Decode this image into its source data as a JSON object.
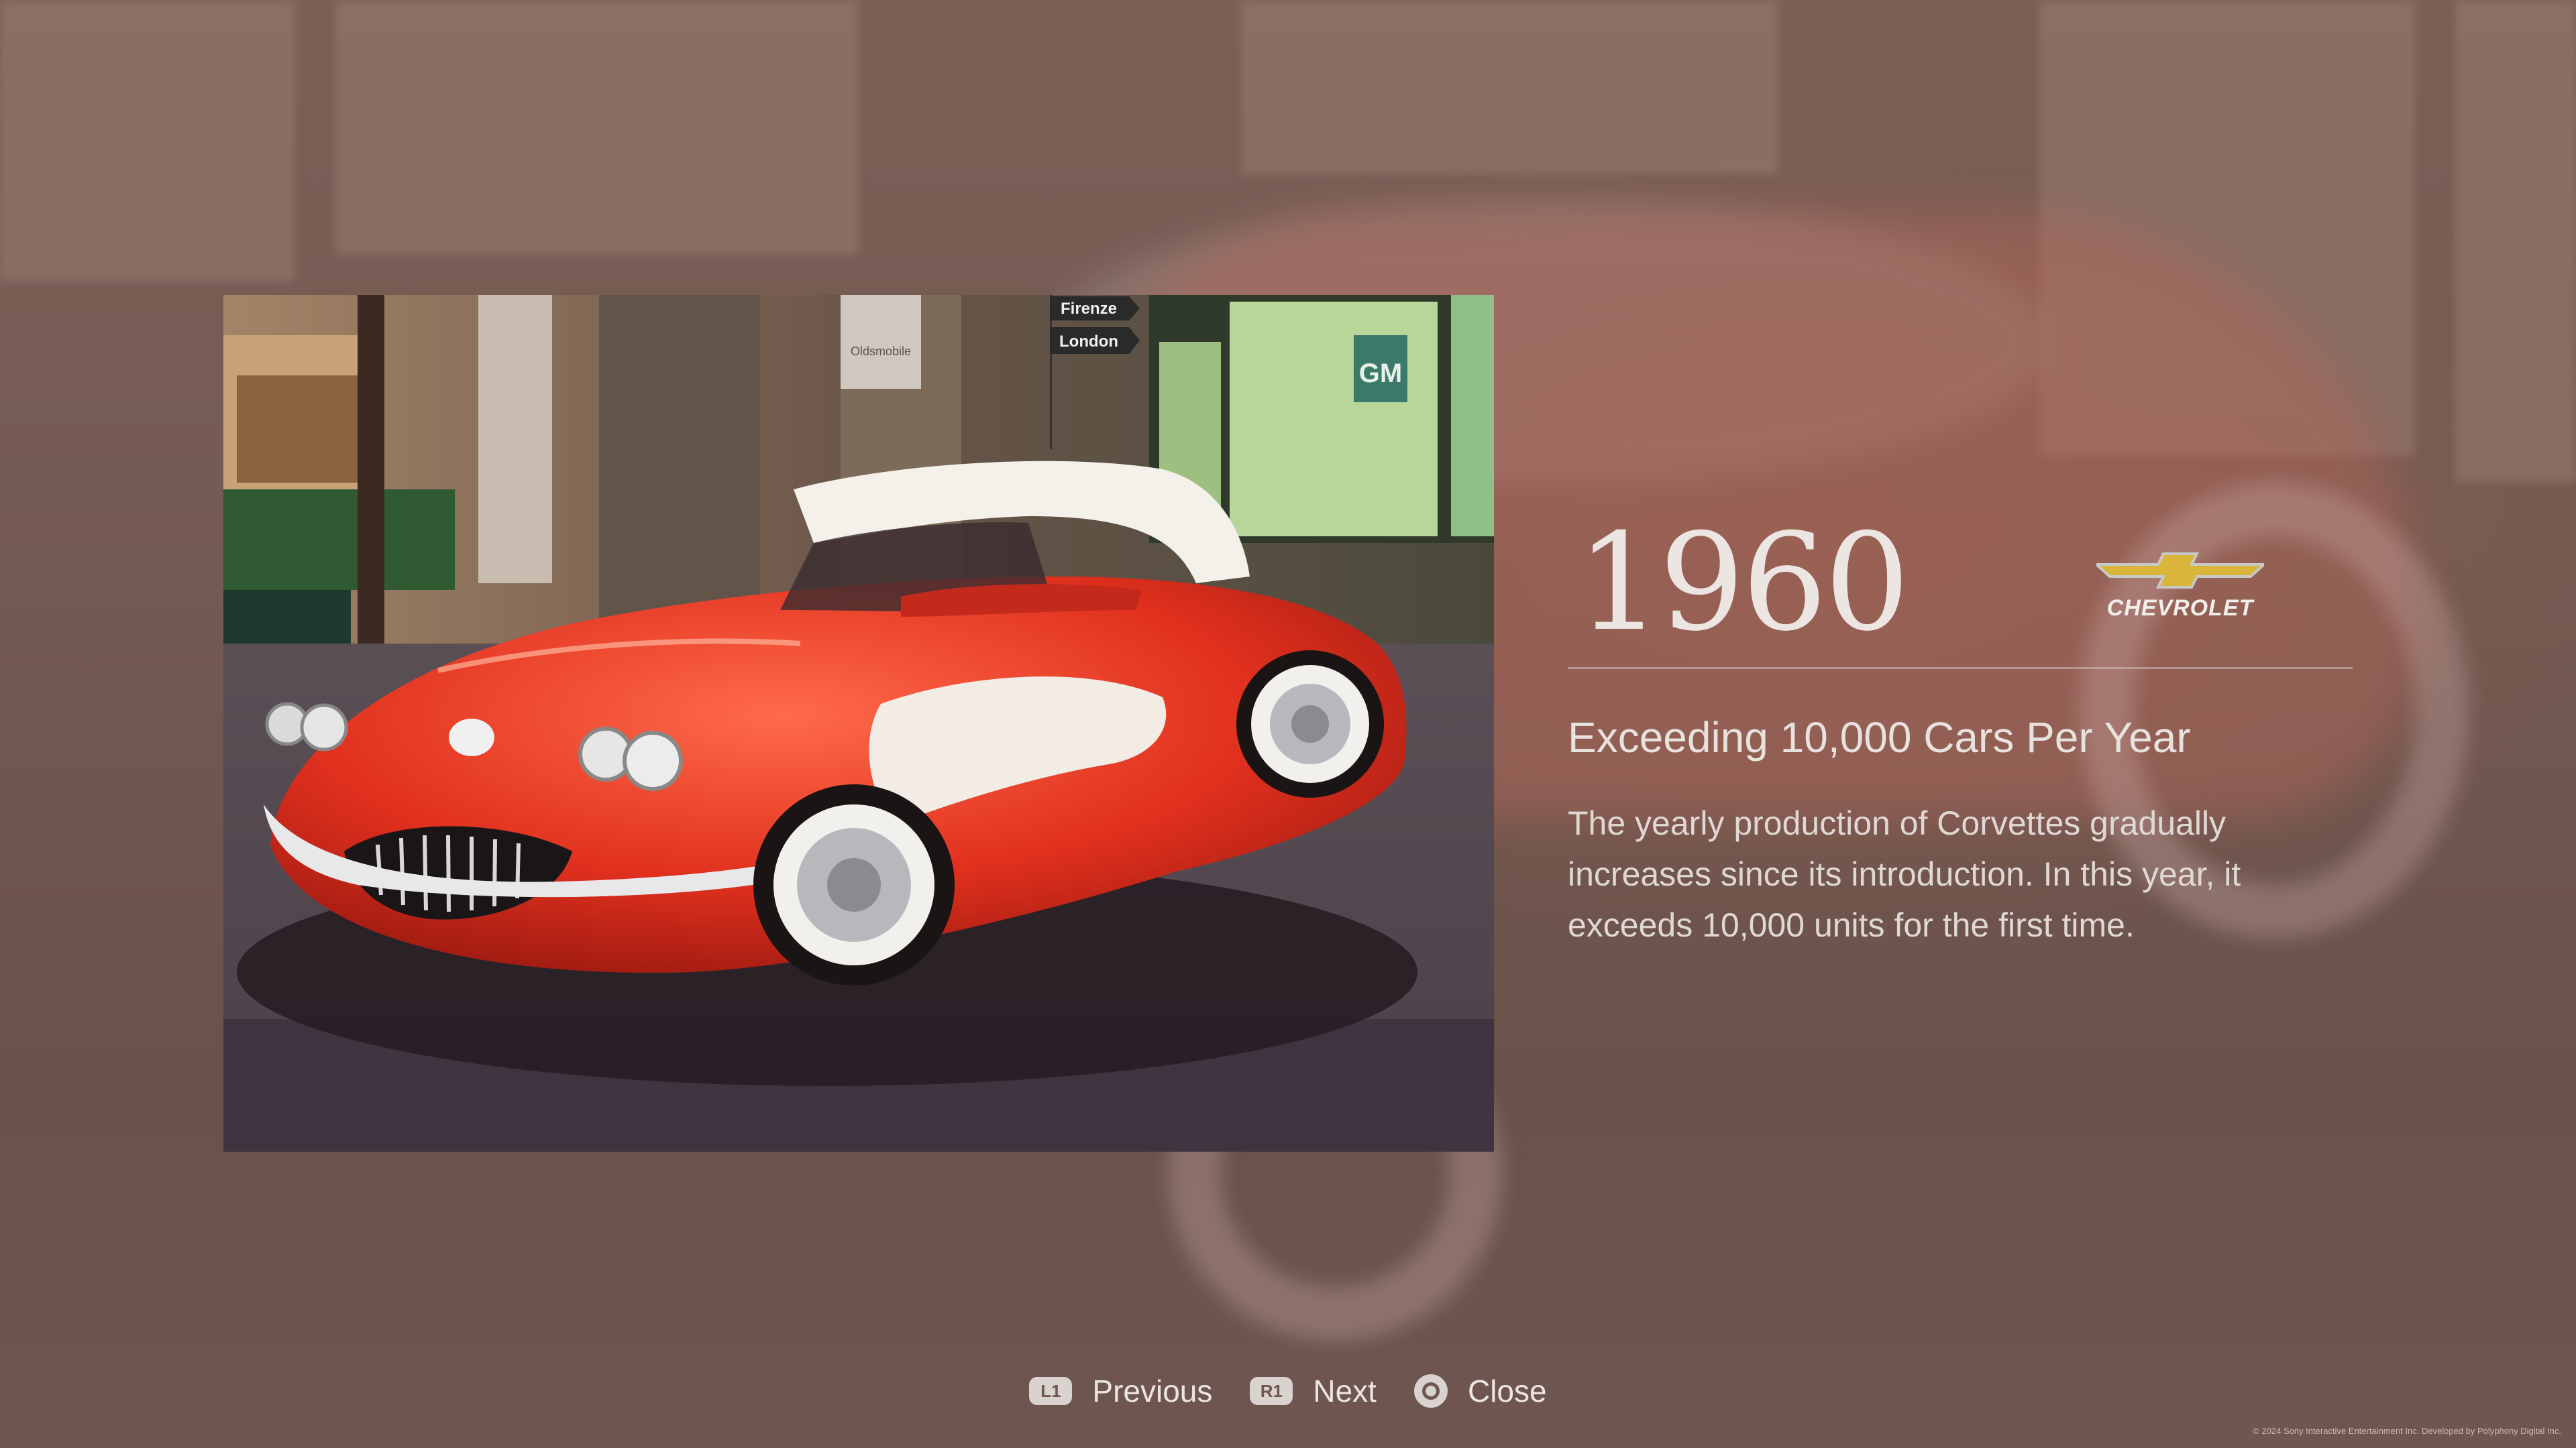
{
  "panel": {
    "year": "1960",
    "brand": {
      "name": "CHEVROLET",
      "logo_icon": "chevrolet-bowtie-icon",
      "logo_color": "#d9b63a"
    },
    "headline": "Exceeding 10,000 Cars Per Year",
    "description": "The yearly production of Corvettes gradually increases since its introduction. In this year, it exceeds 10,000 units for the first time."
  },
  "photo": {
    "signs": [
      "Firenze",
      "London"
    ],
    "building_sign": "Oldsmobile",
    "banner_text": "GM"
  },
  "controls": {
    "previous": {
      "key": "L1",
      "label": "Previous"
    },
    "next": {
      "key": "R1",
      "label": "Next"
    },
    "close": {
      "key_icon": "circle-button-icon",
      "label": "Close"
    }
  },
  "footer": {
    "copyright": "© 2024 Sony Interactive Entertainment Inc. Developed by Polyphony Digital Inc."
  },
  "colors": {
    "background": "#6e544c",
    "text_primary": "#ece6e3",
    "car_red": "#e0301e"
  }
}
